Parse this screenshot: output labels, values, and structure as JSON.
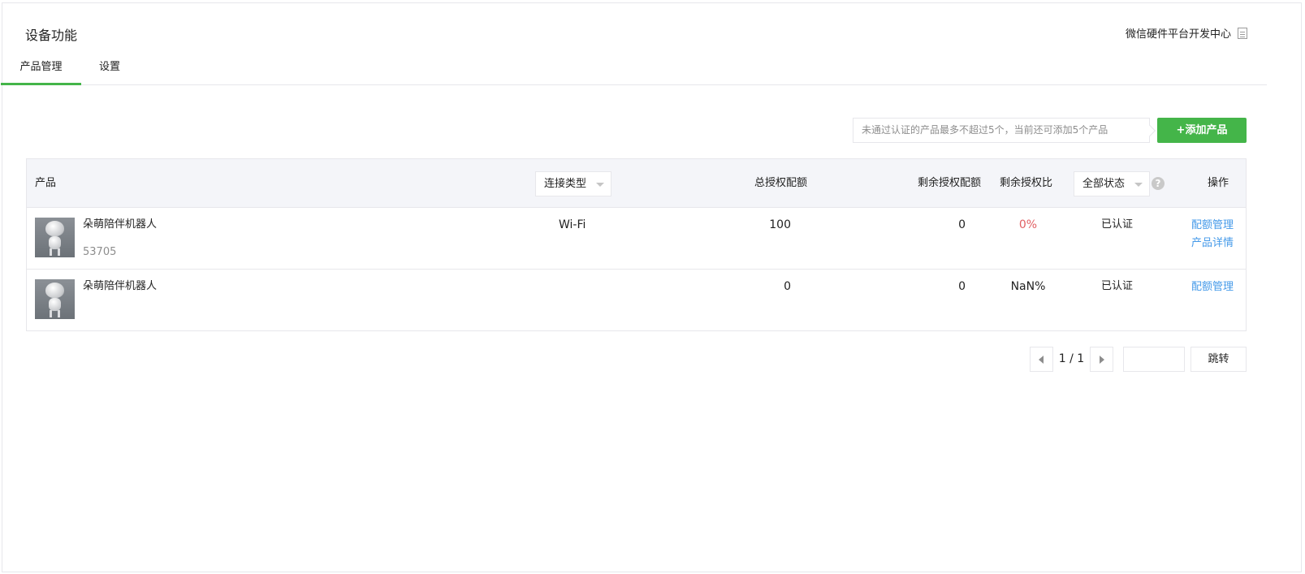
{
  "header": {
    "title": "设备功能",
    "dev_center_link": "微信硬件平台开发中心",
    "dev_center_icon": "document-icon"
  },
  "tabs": [
    {
      "label": "产品管理",
      "active": true
    },
    {
      "label": "设置",
      "active": false
    }
  ],
  "toolbar": {
    "tip": "未通过认证的产品最多不超过5个，当前还可添加5个产品",
    "add_button": "+添加产品"
  },
  "table": {
    "columns": {
      "product": "产品",
      "connection_type": "连接类型",
      "total_quota": "总授权配额",
      "remaining_quota": "剩余授权配额",
      "remaining_ratio": "剩余授权比",
      "status_filter": "全部状态",
      "status_help": "?",
      "operations": "操作"
    },
    "rows": [
      {
        "name": "朵萌陪伴机器人",
        "id": "53705",
        "connection": "Wi-Fi",
        "total_quota": "100",
        "remaining_quota": "0",
        "ratio": "0%",
        "ratio_color": "#e15f63",
        "status": "已认证",
        "operations": [
          "配额管理",
          "产品详情"
        ]
      },
      {
        "name": "朵萌陪伴机器人",
        "id": "",
        "connection": "",
        "total_quota": "0",
        "remaining_quota": "0",
        "ratio": "NaN%",
        "ratio_color": "#222222",
        "status": "已认证",
        "operations": [
          "配额管理"
        ]
      }
    ]
  },
  "pagination": {
    "page_display": "1 / 1",
    "jump_input_value": "",
    "jump_button": "跳转"
  },
  "colors": {
    "accent": "#44b549",
    "link": "#459ae9",
    "danger": "#e15f63"
  }
}
